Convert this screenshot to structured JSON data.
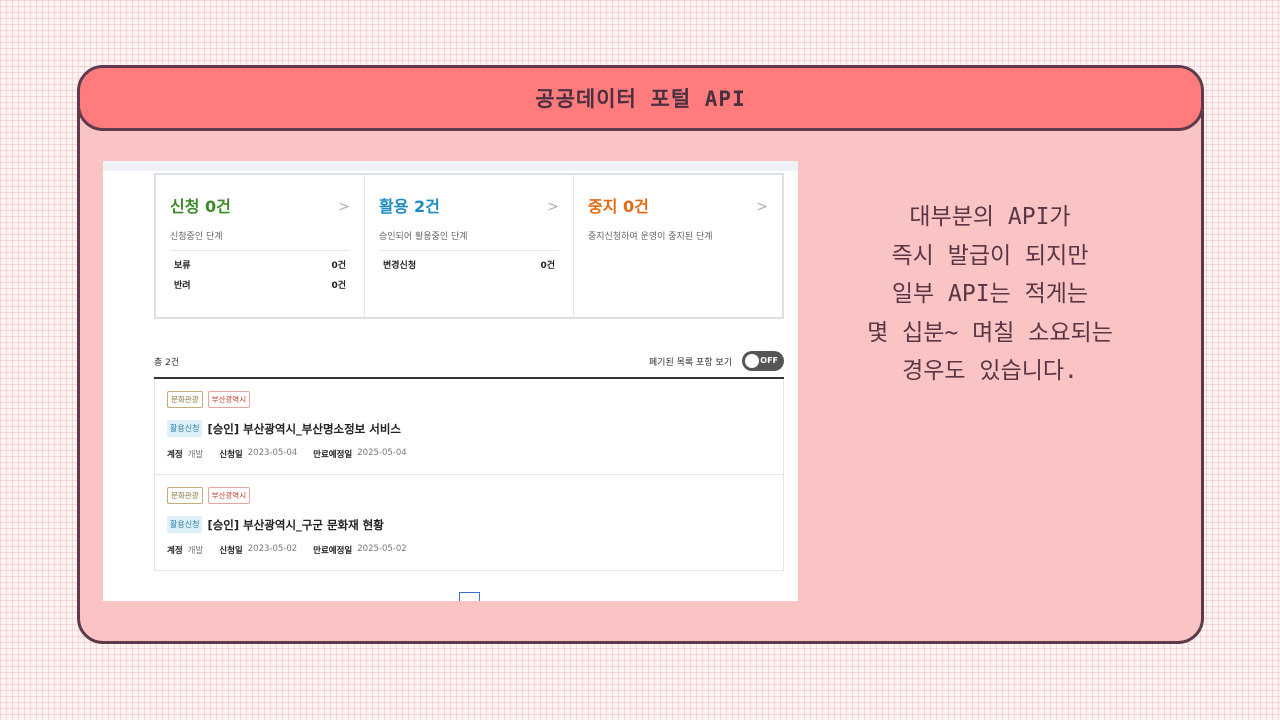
{
  "slide": {
    "title": "공공데이터 포털 API",
    "description_lines": [
      "대부분의 API가",
      "즉시 발급이 되지만",
      "일부 API는 적게는",
      "몇 십분~ 며칠 소요되는",
      "경우도 있습니다."
    ]
  },
  "summary": {
    "boxes": [
      {
        "title": "신청 0건",
        "color": "#3d8a2a",
        "desc": "신청중인 단계",
        "rows": [
          {
            "label": "보류",
            "value": "0건"
          },
          {
            "label": "반려",
            "value": "0건"
          }
        ]
      },
      {
        "title": "활용 2건",
        "color": "#1c8bc0",
        "desc": "승인되어 활용중인 단계",
        "rows": [
          {
            "label": "변경신청",
            "value": "0건"
          }
        ]
      },
      {
        "title": "중지 0건",
        "color": "#e36a14",
        "desc": "중지신청하여 운영이 중지된 단계",
        "rows": []
      }
    ],
    "arrow": ">"
  },
  "list": {
    "total": "총 2건",
    "toggle_label": "폐기된 목록 포함 보기",
    "toggle_state": "OFF",
    "items": [
      {
        "tags": [
          "문화관광",
          "부산광역시"
        ],
        "status": "활용신청",
        "title": "[승인] 부산광역시_부산명소정보 서비스",
        "account_label": "계정",
        "account": "개발",
        "apply_label": "신청일",
        "apply_date": "2023-05-04",
        "expire_label": "만료예정일",
        "expire_date": "2025-05-04"
      },
      {
        "tags": [
          "문화관광",
          "부산광역시"
        ],
        "status": "활용신청",
        "title": "[승인] 부산광역시_구군 문화재 현황",
        "account_label": "계정",
        "account": "개발",
        "apply_label": "신청일",
        "apply_date": "2023-05-02",
        "expire_label": "만료예정일",
        "expire_date": "2025-05-02"
      }
    ]
  }
}
